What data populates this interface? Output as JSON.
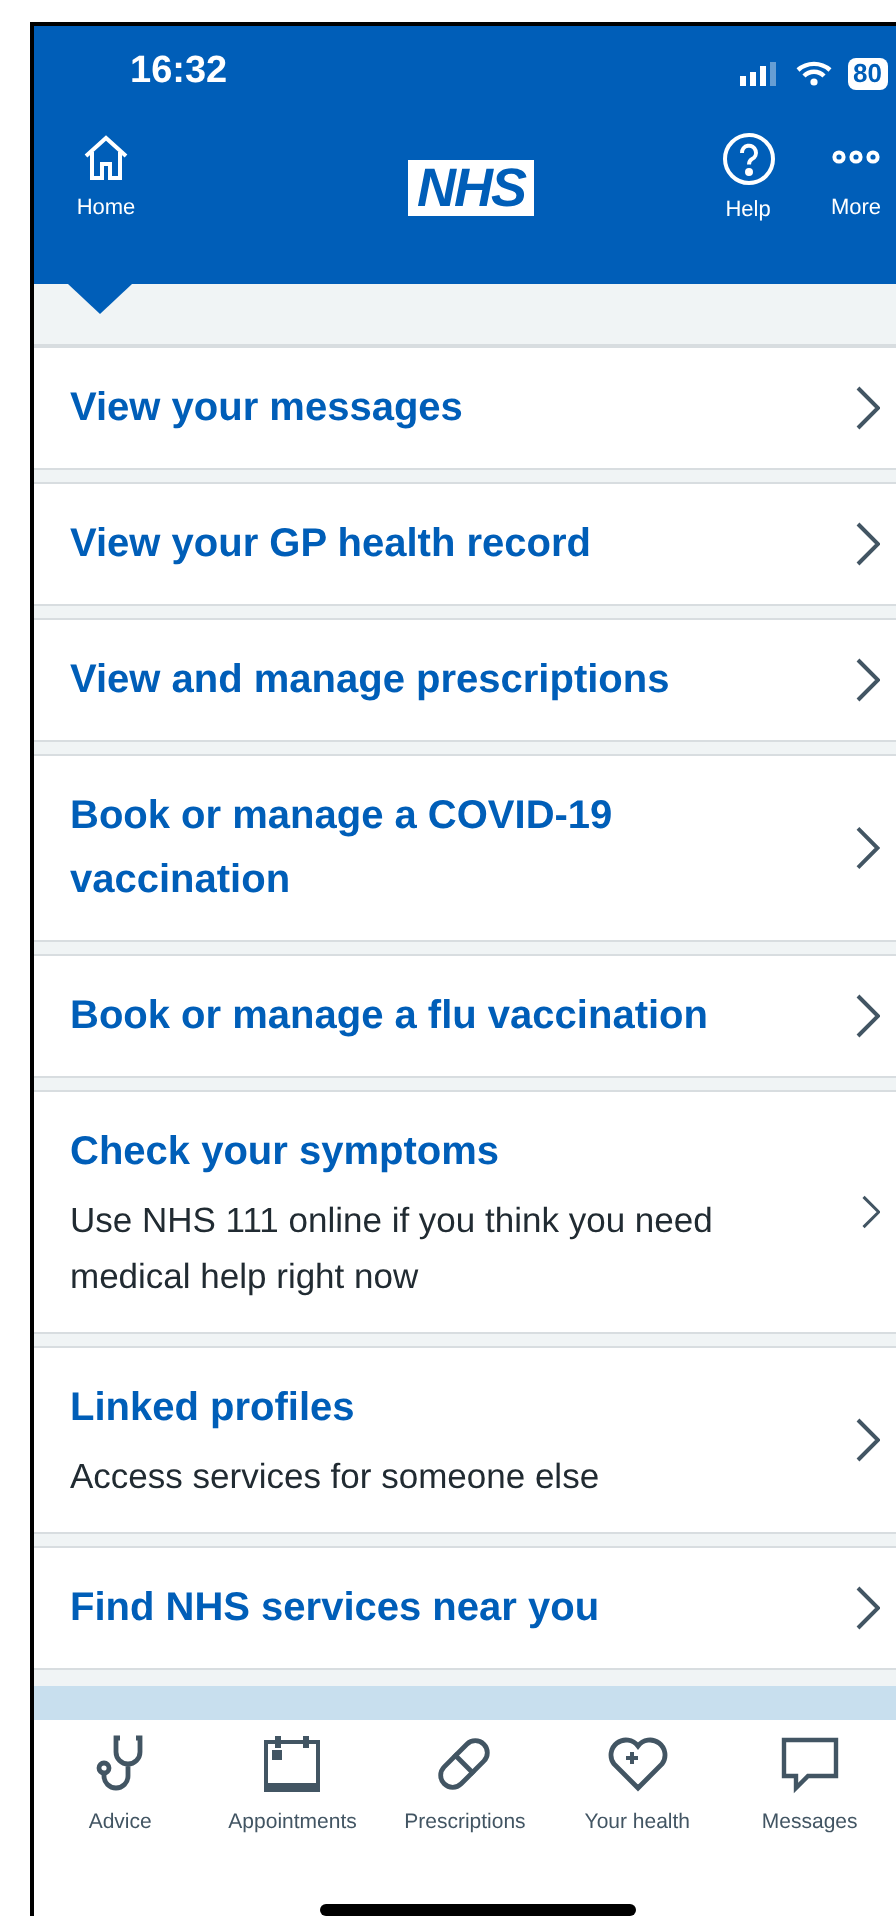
{
  "status_bar": {
    "time": "16:32",
    "battery": "80"
  },
  "header": {
    "logo": "NHS",
    "nav": [
      {
        "kind": "home",
        "label": "Home",
        "selected": true
      },
      {
        "kind": "help",
        "label": "Help",
        "selected": false
      },
      {
        "kind": "more",
        "label": "More",
        "selected": false
      }
    ]
  },
  "menu": [
    {
      "title": "View your messages"
    },
    {
      "title": "View your GP health record"
    },
    {
      "title": "View and manage prescriptions"
    },
    {
      "title": "Book or manage a COVID-19 vaccination"
    },
    {
      "title": "Book or manage a flu vaccination"
    },
    {
      "title": "Check your symptoms",
      "description": "Use NHS 111 online if you think you need medical help right now"
    },
    {
      "title": "Linked profiles",
      "description": "Access services for someone else"
    },
    {
      "title": "Find NHS services near you"
    }
  ],
  "tab_bar": [
    {
      "kind": "advice",
      "label": "Advice"
    },
    {
      "kind": "appointments",
      "label": "Appointments"
    },
    {
      "kind": "prescriptions",
      "label": "Prescriptions"
    },
    {
      "kind": "health",
      "label": "Your health"
    },
    {
      "kind": "messages",
      "label": "Messages"
    }
  ]
}
